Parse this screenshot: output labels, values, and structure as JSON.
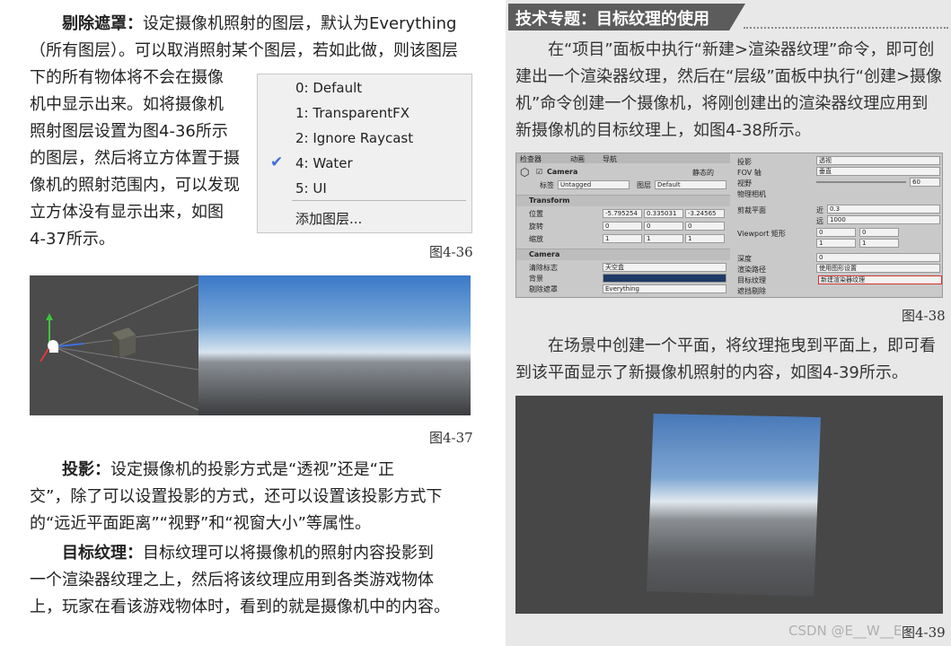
{
  "left": {
    "para_mask_label": "剔除遮罩：",
    "para_mask_lines": [
      "设定摄像机照射的图层，默认为Everything",
      "（所有图层）。可以取消照射某个图层，若如此做，则该图层"
    ],
    "para_mask_narrow_lines": [
      "下的所有物体将不会在摄像",
      "机中显示出来。如将摄像机",
      "照射图层设置为图4-36所示",
      "的图层，然后将立方体置于摄",
      "像机的照射范围内，可以发现",
      "立方体没有显示出来，如图",
      "4-37所示。"
    ],
    "layer_menu": {
      "items": [
        "0: Default",
        "1: TransparentFX",
        "2: Ignore Raycast",
        "4: Water",
        "5: UI"
      ],
      "checked_index": 3,
      "add_layer": "添加图层..."
    },
    "fig_36": "图4-36",
    "fig_37": "图4-37",
    "para_proj_label": "投影：",
    "para_proj_lines": [
      "设定摄像机的投影方式是“透视”还是“正",
      "交”，除了可以设置投影的方式，还可以设置该投影方式下",
      "的“远近平面距离”“视野”和“视窗大小”等属性。"
    ],
    "para_target_label": "目标纹理：",
    "para_target_lines": [
      "目标纹理可以将摄像机的照射内容投影到",
      "一个渲染器纹理之上，然后将该纹理应用到各类游戏物体",
      "上，玩家在看该游戏物体时，看到的就是摄像机中的内容。"
    ]
  },
  "right": {
    "banner_prefix": "技术专题：",
    "banner_title": "目标纹理的使用",
    "para_tech_lines": [
      "在“项目”面板中执行“新建>渲染器纹理”命令，即可创",
      "建出一个渲染器纹理，然后在“层级”面板中执行“创建>摄像",
      "机”命令创建一个摄像机，将刚创建出的渲染器纹理应用到",
      "新摄像机的目标纹理上，如图4-38所示。"
    ],
    "inspector": {
      "tabs": [
        "检查器",
        "动画",
        "导航"
      ],
      "object_name": "Camera",
      "static_label": "静态的",
      "tag_label": "标签",
      "tag_value": "Untagged",
      "layer_label": "图层",
      "layer_value": "Default",
      "transform_title": "Transform",
      "position_label": "位置",
      "rotation_label": "旋转",
      "scale_label": "缩放",
      "position": [
        "-5.795254",
        "0.335031",
        "-3.24565"
      ],
      "rotation": [
        "0",
        "0",
        "0"
      ],
      "scale": [
        "1",
        "1",
        "1"
      ],
      "camera_title": "Camera",
      "clear_flags_label": "清除标志",
      "clear_flags_value": "天空盒",
      "background_label": "背景",
      "culling_mask_label": "剔除遮罩",
      "culling_mask_value": "Everything",
      "projection_label": "投影",
      "projection_value": "透视",
      "fov_axis_label": "FOV 轴",
      "fov_axis_value": "垂直",
      "fov_label": "视野",
      "fov_value": "60",
      "physical_label": "物理相机",
      "clip_label": "剪裁平面",
      "near_label": "近",
      "near_value": "0.3",
      "far_label": "远",
      "far_value": "1000",
      "viewport_label": "Viewport 矩形",
      "vx": "0",
      "vy": "0",
      "vw": "1",
      "vh": "1",
      "depth_label": "深度",
      "depth_value": "0",
      "render_path_label": "渲染路径",
      "render_path_value": "使用图形设置",
      "target_label": "目标纹理",
      "target_value": "新建渲染器纹理",
      "occlusion_label": "遮挡剔除"
    },
    "fig_38": "图4-38",
    "para_plane_lines": [
      "在场景中创建一个平面，将纹理拖曳到平面上，即可看",
      "到该平面显示了新摄像机照射的内容，如图4-39所示。"
    ],
    "fig_39": "图4-39",
    "watermark": "CSDN @E__W__E"
  }
}
